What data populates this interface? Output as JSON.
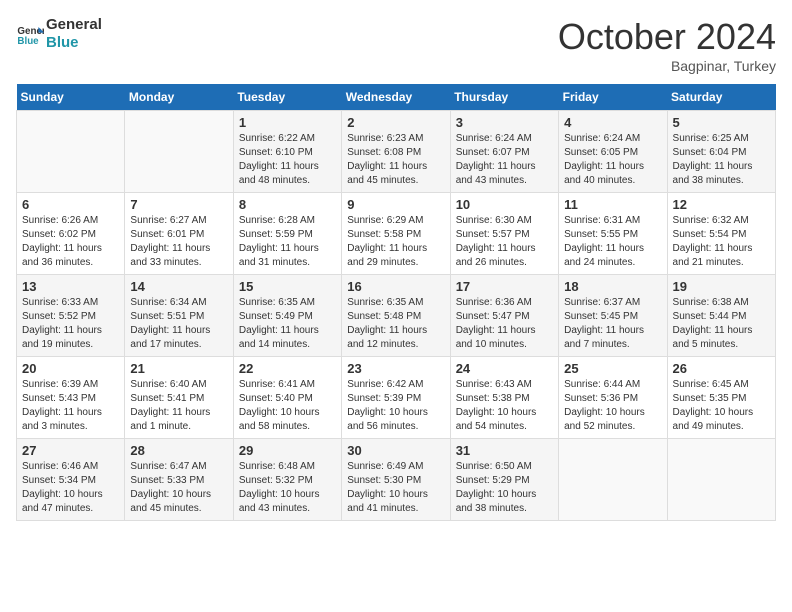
{
  "header": {
    "logo_line1": "General",
    "logo_line2": "Blue",
    "month_title": "October 2024",
    "subtitle": "Bagpinar, Turkey"
  },
  "days_of_week": [
    "Sunday",
    "Monday",
    "Tuesday",
    "Wednesday",
    "Thursday",
    "Friday",
    "Saturday"
  ],
  "weeks": [
    [
      {
        "num": "",
        "info": ""
      },
      {
        "num": "",
        "info": ""
      },
      {
        "num": "1",
        "info": "Sunrise: 6:22 AM\nSunset: 6:10 PM\nDaylight: 11 hours and 48 minutes."
      },
      {
        "num": "2",
        "info": "Sunrise: 6:23 AM\nSunset: 6:08 PM\nDaylight: 11 hours and 45 minutes."
      },
      {
        "num": "3",
        "info": "Sunrise: 6:24 AM\nSunset: 6:07 PM\nDaylight: 11 hours and 43 minutes."
      },
      {
        "num": "4",
        "info": "Sunrise: 6:24 AM\nSunset: 6:05 PM\nDaylight: 11 hours and 40 minutes."
      },
      {
        "num": "5",
        "info": "Sunrise: 6:25 AM\nSunset: 6:04 PM\nDaylight: 11 hours and 38 minutes."
      }
    ],
    [
      {
        "num": "6",
        "info": "Sunrise: 6:26 AM\nSunset: 6:02 PM\nDaylight: 11 hours and 36 minutes."
      },
      {
        "num": "7",
        "info": "Sunrise: 6:27 AM\nSunset: 6:01 PM\nDaylight: 11 hours and 33 minutes."
      },
      {
        "num": "8",
        "info": "Sunrise: 6:28 AM\nSunset: 5:59 PM\nDaylight: 11 hours and 31 minutes."
      },
      {
        "num": "9",
        "info": "Sunrise: 6:29 AM\nSunset: 5:58 PM\nDaylight: 11 hours and 29 minutes."
      },
      {
        "num": "10",
        "info": "Sunrise: 6:30 AM\nSunset: 5:57 PM\nDaylight: 11 hours and 26 minutes."
      },
      {
        "num": "11",
        "info": "Sunrise: 6:31 AM\nSunset: 5:55 PM\nDaylight: 11 hours and 24 minutes."
      },
      {
        "num": "12",
        "info": "Sunrise: 6:32 AM\nSunset: 5:54 PM\nDaylight: 11 hours and 21 minutes."
      }
    ],
    [
      {
        "num": "13",
        "info": "Sunrise: 6:33 AM\nSunset: 5:52 PM\nDaylight: 11 hours and 19 minutes."
      },
      {
        "num": "14",
        "info": "Sunrise: 6:34 AM\nSunset: 5:51 PM\nDaylight: 11 hours and 17 minutes."
      },
      {
        "num": "15",
        "info": "Sunrise: 6:35 AM\nSunset: 5:49 PM\nDaylight: 11 hours and 14 minutes."
      },
      {
        "num": "16",
        "info": "Sunrise: 6:35 AM\nSunset: 5:48 PM\nDaylight: 11 hours and 12 minutes."
      },
      {
        "num": "17",
        "info": "Sunrise: 6:36 AM\nSunset: 5:47 PM\nDaylight: 11 hours and 10 minutes."
      },
      {
        "num": "18",
        "info": "Sunrise: 6:37 AM\nSunset: 5:45 PM\nDaylight: 11 hours and 7 minutes."
      },
      {
        "num": "19",
        "info": "Sunrise: 6:38 AM\nSunset: 5:44 PM\nDaylight: 11 hours and 5 minutes."
      }
    ],
    [
      {
        "num": "20",
        "info": "Sunrise: 6:39 AM\nSunset: 5:43 PM\nDaylight: 11 hours and 3 minutes."
      },
      {
        "num": "21",
        "info": "Sunrise: 6:40 AM\nSunset: 5:41 PM\nDaylight: 11 hours and 1 minute."
      },
      {
        "num": "22",
        "info": "Sunrise: 6:41 AM\nSunset: 5:40 PM\nDaylight: 10 hours and 58 minutes."
      },
      {
        "num": "23",
        "info": "Sunrise: 6:42 AM\nSunset: 5:39 PM\nDaylight: 10 hours and 56 minutes."
      },
      {
        "num": "24",
        "info": "Sunrise: 6:43 AM\nSunset: 5:38 PM\nDaylight: 10 hours and 54 minutes."
      },
      {
        "num": "25",
        "info": "Sunrise: 6:44 AM\nSunset: 5:36 PM\nDaylight: 10 hours and 52 minutes."
      },
      {
        "num": "26",
        "info": "Sunrise: 6:45 AM\nSunset: 5:35 PM\nDaylight: 10 hours and 49 minutes."
      }
    ],
    [
      {
        "num": "27",
        "info": "Sunrise: 6:46 AM\nSunset: 5:34 PM\nDaylight: 10 hours and 47 minutes."
      },
      {
        "num": "28",
        "info": "Sunrise: 6:47 AM\nSunset: 5:33 PM\nDaylight: 10 hours and 45 minutes."
      },
      {
        "num": "29",
        "info": "Sunrise: 6:48 AM\nSunset: 5:32 PM\nDaylight: 10 hours and 43 minutes."
      },
      {
        "num": "30",
        "info": "Sunrise: 6:49 AM\nSunset: 5:30 PM\nDaylight: 10 hours and 41 minutes."
      },
      {
        "num": "31",
        "info": "Sunrise: 6:50 AM\nSunset: 5:29 PM\nDaylight: 10 hours and 38 minutes."
      },
      {
        "num": "",
        "info": ""
      },
      {
        "num": "",
        "info": ""
      }
    ]
  ]
}
